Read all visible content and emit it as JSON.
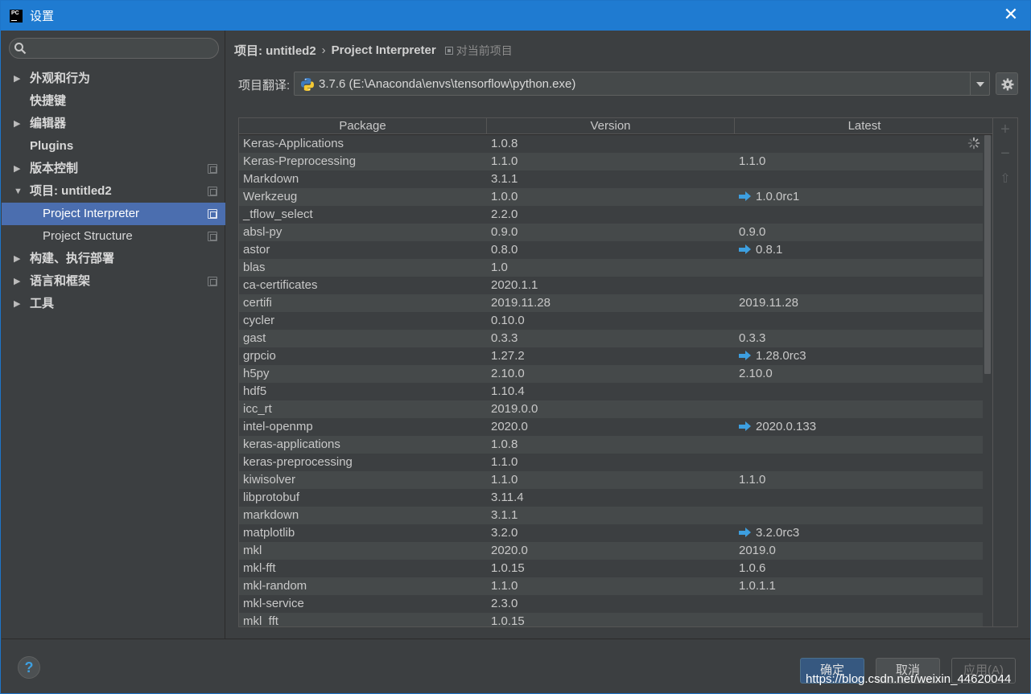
{
  "window": {
    "title": "设置",
    "app_icon_text": "PC"
  },
  "sidebar": {
    "search_placeholder": "",
    "items": [
      {
        "label": "外观和行为",
        "expandable": true,
        "arrow": "▶",
        "bold": true
      },
      {
        "label": "快捷键",
        "expandable": false,
        "bold": true
      },
      {
        "label": "编辑器",
        "expandable": true,
        "arrow": "▶",
        "bold": true
      },
      {
        "label": "Plugins",
        "expandable": false,
        "bold": true
      },
      {
        "label": "版本控制",
        "expandable": true,
        "arrow": "▶",
        "bold": true,
        "project_icon": true
      },
      {
        "label": "项目: untitled2",
        "expandable": true,
        "arrow": "▼",
        "bold": true,
        "project_icon": true
      },
      {
        "label": "Project Interpreter",
        "sub": true,
        "selected": true,
        "project_icon": true
      },
      {
        "label": "Project Structure",
        "sub": true,
        "project_icon": true
      },
      {
        "label": "构建、执行部署",
        "expandable": true,
        "arrow": "▶",
        "bold": true
      },
      {
        "label": "语言和框架",
        "expandable": true,
        "arrow": "▶",
        "bold": true,
        "project_icon": true
      },
      {
        "label": "工具",
        "expandable": true,
        "arrow": "▶",
        "bold": true
      }
    ]
  },
  "breadcrumb": {
    "project": "项目: untitled2",
    "separator": "›",
    "page": "Project Interpreter",
    "scope": "对当前项目"
  },
  "interpreter": {
    "label": "项目翻译:",
    "value": "3.7.6 (E:\\Anaconda\\envs\\tensorflow\\python.exe)"
  },
  "table": {
    "headers": [
      "Package",
      "Version",
      "Latest"
    ],
    "rows": [
      {
        "package": "Keras-Applications",
        "version": "1.0.8",
        "latest": "",
        "upgrade": false
      },
      {
        "package": "Keras-Preprocessing",
        "version": "1.1.0",
        "latest": "1.1.0",
        "upgrade": false
      },
      {
        "package": "Markdown",
        "version": "3.1.1",
        "latest": "",
        "upgrade": false
      },
      {
        "package": "Werkzeug",
        "version": "1.0.0",
        "latest": "1.0.0rc1",
        "upgrade": true
      },
      {
        "package": "_tflow_select",
        "version": "2.2.0",
        "latest": "",
        "upgrade": false
      },
      {
        "package": "absl-py",
        "version": "0.9.0",
        "latest": "0.9.0",
        "upgrade": false
      },
      {
        "package": "astor",
        "version": "0.8.0",
        "latest": "0.8.1",
        "upgrade": true
      },
      {
        "package": "blas",
        "version": "1.0",
        "latest": "",
        "upgrade": false
      },
      {
        "package": "ca-certificates",
        "version": "2020.1.1",
        "latest": "",
        "upgrade": false
      },
      {
        "package": "certifi",
        "version": "2019.11.28",
        "latest": "2019.11.28",
        "upgrade": false
      },
      {
        "package": "cycler",
        "version": "0.10.0",
        "latest": "",
        "upgrade": false
      },
      {
        "package": "gast",
        "version": "0.3.3",
        "latest": "0.3.3",
        "upgrade": false
      },
      {
        "package": "grpcio",
        "version": "1.27.2",
        "latest": "1.28.0rc3",
        "upgrade": true
      },
      {
        "package": "h5py",
        "version": "2.10.0",
        "latest": "2.10.0",
        "upgrade": false
      },
      {
        "package": "hdf5",
        "version": "1.10.4",
        "latest": "",
        "upgrade": false
      },
      {
        "package": "icc_rt",
        "version": "2019.0.0",
        "latest": "",
        "upgrade": false
      },
      {
        "package": "intel-openmp",
        "version": "2020.0",
        "latest": "2020.0.133",
        "upgrade": true
      },
      {
        "package": "keras-applications",
        "version": "1.0.8",
        "latest": "",
        "upgrade": false
      },
      {
        "package": "keras-preprocessing",
        "version": "1.1.0",
        "latest": "",
        "upgrade": false
      },
      {
        "package": "kiwisolver",
        "version": "1.1.0",
        "latest": "1.1.0",
        "upgrade": false
      },
      {
        "package": "libprotobuf",
        "version": "3.11.4",
        "latest": "",
        "upgrade": false
      },
      {
        "package": "markdown",
        "version": "3.1.1",
        "latest": "",
        "upgrade": false
      },
      {
        "package": "matplotlib",
        "version": "3.2.0",
        "latest": "3.2.0rc3",
        "upgrade": true
      },
      {
        "package": "mkl",
        "version": "2020.0",
        "latest": "2019.0",
        "upgrade": false
      },
      {
        "package": "mkl-fft",
        "version": "1.0.15",
        "latest": "1.0.6",
        "upgrade": false
      },
      {
        "package": "mkl-random",
        "version": "1.1.0",
        "latest": "1.0.1.1",
        "upgrade": false
      },
      {
        "package": "mkl-service",
        "version": "2.3.0",
        "latest": "",
        "upgrade": false
      },
      {
        "package": "mkl_fft",
        "version": "1.0.15",
        "latest": "",
        "upgrade": false
      }
    ]
  },
  "side_tools": {
    "add": "+",
    "remove": "−",
    "upgrade": "⇧"
  },
  "footer": {
    "help": "?",
    "ok": "确定",
    "cancel": "取消",
    "apply": "应用(A)"
  },
  "watermark": "https://blog.csdn.net/weixin_44620044",
  "colors": {
    "titlebar": "#1f7bd1",
    "selection": "#4b6eaf",
    "upgrade_arrow": "#3d9fe0"
  }
}
